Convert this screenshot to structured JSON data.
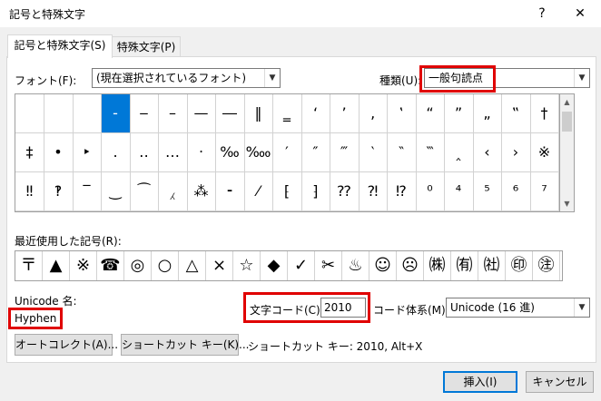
{
  "window": {
    "title": "記号と特殊文字",
    "help_glyph": "?",
    "close_glyph": "✕"
  },
  "tabs": [
    {
      "label": "記号と特殊文字(S)",
      "active": true
    },
    {
      "label": "特殊文字(P)",
      "active": false
    }
  ],
  "font": {
    "label": "フォント(F):",
    "value": "(現在選択されているフォント)"
  },
  "subset": {
    "label": "種類(U):",
    "value": "一般句読点"
  },
  "symbol_grid": {
    "rows": [
      [
        "",
        "",
        "",
        "‐",
        "‒",
        "–",
        "—",
        "―",
        "‖",
        "‗",
        "‘",
        "’",
        "‚",
        "‛",
        "“",
        "”",
        "„",
        "‟",
        "†"
      ],
      [
        "‡",
        "•",
        "‣",
        "․",
        "‥",
        "…",
        "‧",
        "‰",
        "‱",
        "′",
        "″",
        "‴",
        "‵",
        "‶",
        "‷",
        "‸",
        "‹",
        "›",
        "※"
      ],
      [
        "‼",
        "‽",
        "‾",
        "‿",
        "⁀",
        "⁁",
        "⁂",
        "⁃",
        "⁄",
        "⁅",
        "⁆",
        "⁇",
        "⁈",
        "⁉",
        "⁰",
        "⁴",
        "⁵",
        "⁶",
        "⁷"
      ]
    ],
    "selected_index": 3
  },
  "recent": {
    "label": "最近使用した記号(R):",
    "symbols": [
      "〒",
      "▲",
      "※",
      "☎",
      "◎",
      "○",
      "△",
      "×",
      "☆",
      "◆",
      "✓",
      "✂",
      "♨",
      "☺",
      "☹",
      "㈱",
      "㈲",
      "㈳",
      "㊞",
      "㊟"
    ]
  },
  "unicode_name": {
    "label": "Unicode 名:",
    "value": "Hyphen"
  },
  "char_code": {
    "label": "文字コード(C):",
    "value": "2010"
  },
  "code_system": {
    "label": "コード体系(M):",
    "value": "Unicode (16 進)"
  },
  "buttons": {
    "autocorrect": "オートコレクト(A)...",
    "shortcut_key": "ショートカット キー(K)...",
    "insert": "挿入(I)",
    "cancel": "キャンセル"
  },
  "shortcut_info": "ショートカット キー: 2010, Alt+X",
  "colors": {
    "highlight": "#e00000",
    "selection": "#0078d7"
  }
}
